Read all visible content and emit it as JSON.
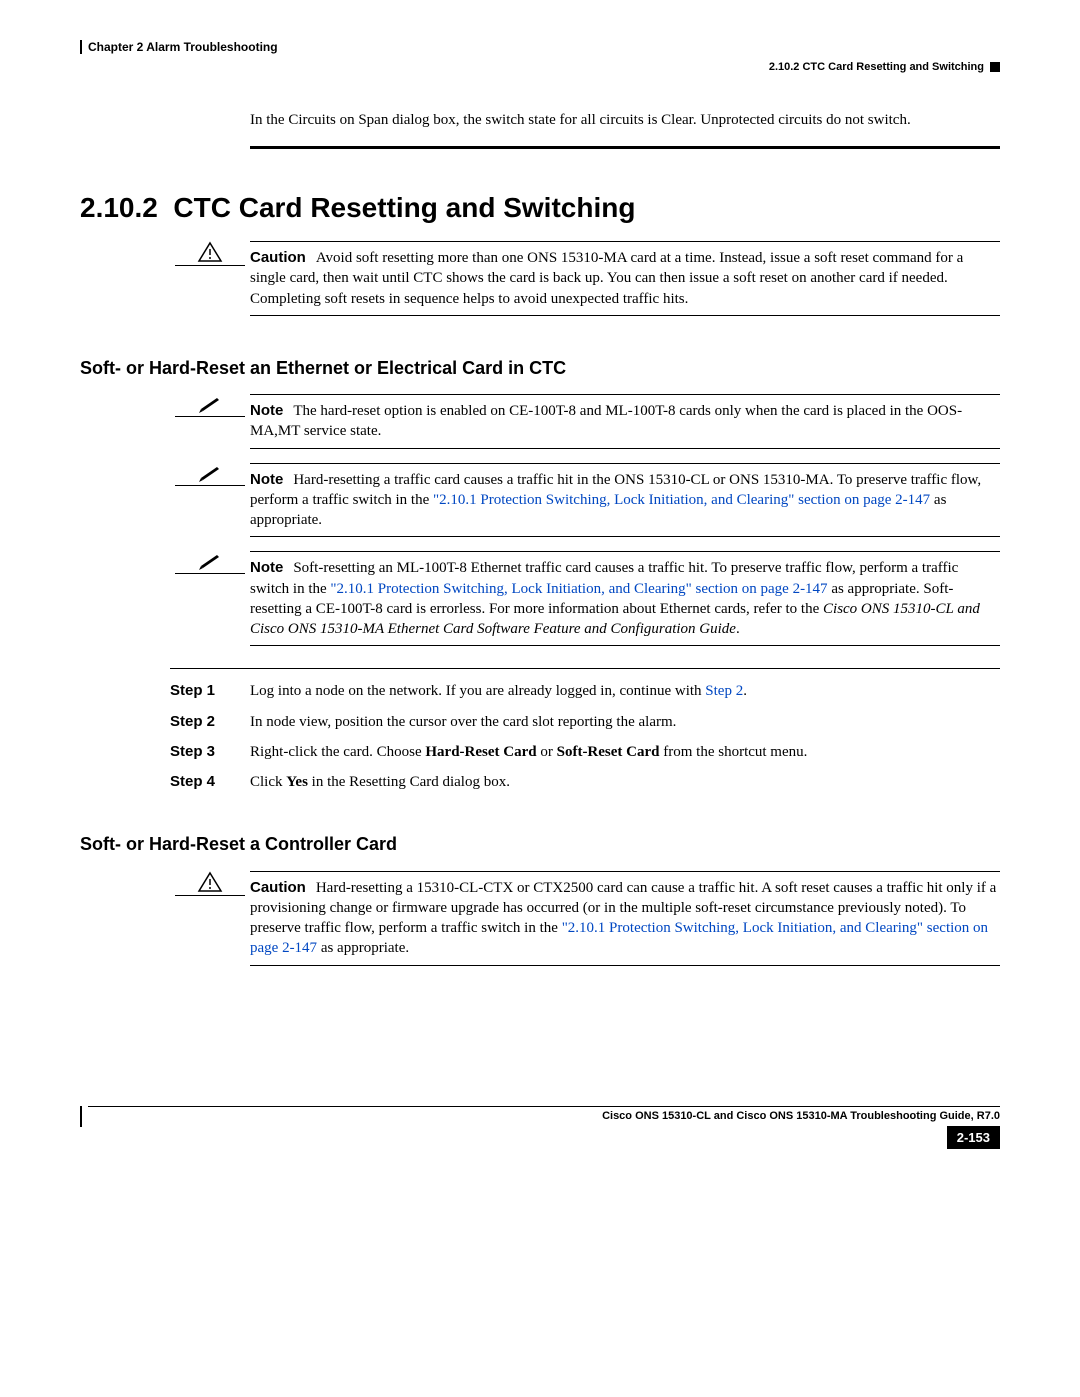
{
  "header": {
    "chapter": "Chapter 2    Alarm Troubleshooting",
    "section_short": "2.10.2   CTC Card Resetting and Switching"
  },
  "intro_text": "In the Circuits on Span dialog box, the switch state for all circuits is Clear. Unprotected circuits do not switch.",
  "section": {
    "number": "2.10.2",
    "title": "CTC Card Resetting and Switching"
  },
  "caution1": {
    "label": "Caution",
    "text": "Avoid soft resetting more than one ONS 15310-MA card at a time. Instead, issue a soft reset command for a single card, then wait until CTC shows the card is back up. You can then issue a soft reset on another card if needed. Completing soft resets in sequence helps to avoid unexpected traffic hits."
  },
  "sub1_title": "Soft- or Hard-Reset an Ethernet or Electrical Card in CTC",
  "note1": {
    "label": "Note",
    "text": "The hard-reset option is enabled on CE-100T-8 and ML-100T-8 cards only when the card is placed in the OOS-MA,MT service state."
  },
  "note2": {
    "label": "Note",
    "pre": "Hard-resetting a traffic card causes a traffic hit in the ONS 15310-CL or ONS 15310-MA. To preserve traffic flow, perform a traffic switch in the ",
    "link": "\"2.10.1  Protection Switching, Lock Initiation, and Clearing\" section on page 2-147",
    "post": " as appropriate."
  },
  "note3": {
    "label": "Note",
    "pre": "Soft-resetting an ML-100T-8 Ethernet traffic card causes a traffic hit. To preserve traffic flow, perform a traffic switch in the ",
    "link": "\"2.10.1  Protection Switching, Lock Initiation, and Clearing\" section on page 2-147",
    "mid": " as appropriate. Soft-resetting a CE-100T-8 card is errorless. For more information about Ethernet cards, refer to the ",
    "italic": "Cisco ONS 15310-CL and Cisco ONS 15310-MA Ethernet Card Software Feature and Configuration Guide",
    "post": "."
  },
  "steps": [
    {
      "label": "Step 1",
      "pre": "Log into a node on the network. If you are already logged in, continue with ",
      "link": "Step 2",
      "post": "."
    },
    {
      "label": "Step 2",
      "text": "In node view, position the cursor over the card slot reporting the alarm."
    },
    {
      "label": "Step 3",
      "pre": "Right-click the card. Choose ",
      "b1": "Hard-Reset Card",
      "mid": " or ",
      "b2": "Soft-Reset Card",
      "post": " from the shortcut menu."
    },
    {
      "label": "Step 4",
      "pre": "Click ",
      "b1": "Yes",
      "post": " in the Resetting Card dialog box."
    }
  ],
  "sub2_title": "Soft- or Hard-Reset a Controller Card",
  "caution2": {
    "label": "Caution",
    "pre": "Hard-resetting a 15310-CL-CTX or CTX2500 card can cause a traffic hit. A soft reset causes a traffic hit only if a provisioning change or firmware upgrade has occurred (or in the multiple soft-reset circumstance previously noted). To preserve traffic flow, perform a traffic switch in the ",
    "link": "\"2.10.1  Protection Switching, Lock Initiation, and Clearing\" section on page 2-147",
    "post": " as appropriate."
  },
  "footer": {
    "book": "Cisco ONS 15310-CL and Cisco ONS 15310-MA Troubleshooting Guide, R7.0",
    "page": "2-153"
  }
}
